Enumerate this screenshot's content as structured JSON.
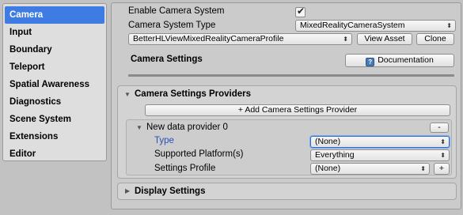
{
  "sidebar": {
    "items": [
      {
        "label": "Camera",
        "selected": true
      },
      {
        "label": "Input"
      },
      {
        "label": "Boundary"
      },
      {
        "label": "Teleport"
      },
      {
        "label": "Spatial Awareness"
      },
      {
        "label": "Diagnostics"
      },
      {
        "label": "Scene System"
      },
      {
        "label": "Extensions"
      },
      {
        "label": "Editor"
      }
    ]
  },
  "camera": {
    "enable_label": "Enable Camera System",
    "enable_checked": true,
    "system_type_label": "Camera System Type",
    "system_type_value": "MixedRealityCameraSystem",
    "profile_value": "BetterHLViewMixedRealityCameraProfile",
    "view_asset_label": "View Asset",
    "clone_label": "Clone",
    "settings_title": "Camera Settings",
    "documentation_label": "Documentation"
  },
  "providers": {
    "title": "Camera Settings Providers",
    "add_label": "+ Add Camera Settings Provider",
    "item_title": "New data provider 0",
    "remove_label": "-",
    "type_label": "Type",
    "type_value": "(None)",
    "platform_label": "Supported Platform(s)",
    "platform_value": "Everything",
    "profile_label": "Settings Profile",
    "profile_value": "(None)",
    "profile_add_label": "+"
  },
  "display": {
    "title": "Display Settings"
  },
  "colors": {
    "selected": "#3e7ce4",
    "type_label": "#2a4fb5"
  }
}
